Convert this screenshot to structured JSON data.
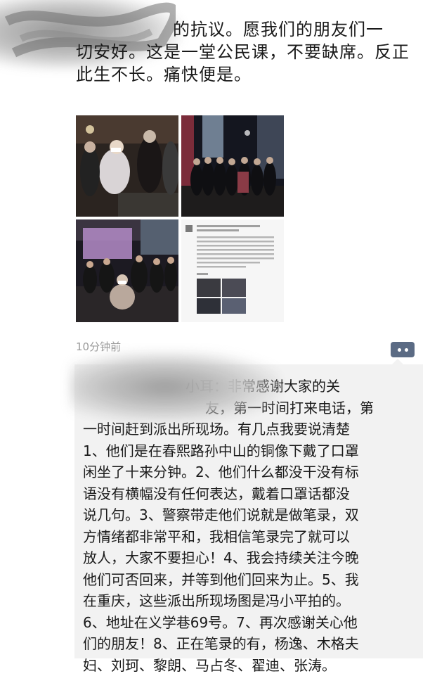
{
  "moment": {
    "text_lines": [
      "",
      "的抗议。愿我们的朋友们一",
      "切安好。这是一堂公民课，不要缺席。反正",
      "此生不长。痛快便是。"
    ]
  },
  "photos": [
    {
      "name": "protest-photo-1"
    },
    {
      "name": "protest-photo-2"
    },
    {
      "name": "protest-photo-3"
    },
    {
      "name": "chat-screenshot-photo"
    }
  ],
  "meta": {
    "timestamp": "10分钟前",
    "more_icon": "more-dots-icon"
  },
  "comment": {
    "lines": [
      "小耳：非常感谢大家的关",
      "友，第一时间打来电话，第",
      "一时间赶到派出所现场。有几点我要说清楚",
      "1、他们是在春熙路孙中山的铜像下戴了口罩",
      "闲坐了十来分钟。2、他们什么都没干没有标",
      "语没有横幅没有任何表达，戴着口罩话都没",
      "说几句。3、警察带走他们说就是做笔录，双",
      "方情绪都非常平和，我相信笔录完了就可以",
      "放人，大家不要担心！4、我会持续关注今晚",
      "他们可否回来，并等到他们回来为止。5、我",
      "在重庆，这些派出所现场图是冯小平拍的。",
      "6、地址在义学巷69号。7、再次感谢关心他",
      "们的朋友！8、正在笔录的有，杨逸、木格夫",
      "妇、刘珂、黎朗、马占冬、翟迪、张涛。"
    ]
  },
  "colors": {
    "comment_bg": "#f2f2f2",
    "more_button": "#5b6b84",
    "timestamp": "#9a9a9a"
  }
}
